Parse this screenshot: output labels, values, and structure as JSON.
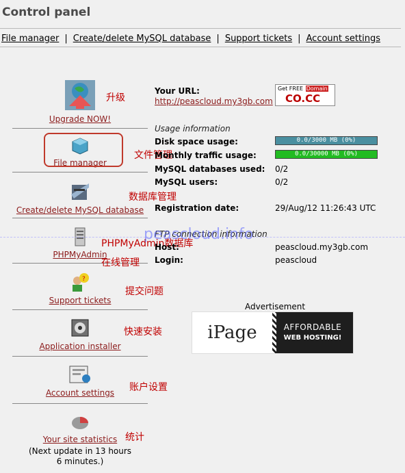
{
  "title": "Control panel",
  "topnav": [
    {
      "label": "File manager"
    },
    {
      "label": "Create/delete MySQL database"
    },
    {
      "label": "Support tickets"
    },
    {
      "label": "Account settings"
    }
  ],
  "sidebar": {
    "items": [
      {
        "label": "Upgrade NOW!",
        "icon": "upgrade-globe-icon",
        "cn": "升级"
      },
      {
        "label": "File manager",
        "icon": "file-manager-cube-icon",
        "cn": "文件管理"
      },
      {
        "label": "Create/delete MySQL database",
        "icon": "mysql-database-icon",
        "cn": "数据库管理"
      },
      {
        "label": "PHPMyAdmin",
        "icon": "phpmyadmin-server-icon",
        "cn": "PHPMyAdmin数据库"
      },
      {
        "label": "Support tickets",
        "icon": "support-people-icon",
        "cn": "提交问题"
      },
      {
        "label": "Application installer",
        "icon": "installer-icon",
        "cn": "快速安装"
      },
      {
        "label": "Account settings",
        "icon": "settings-icon",
        "cn": "账户设置"
      },
      {
        "label": "Your site statistics",
        "icon": "statistics-icon",
        "cn": "统计"
      }
    ],
    "online_cn": "在线管理",
    "stats_note": "(Next update in 13 hours 6 minutes.)"
  },
  "account": {
    "your_url_label": "Your URL:",
    "your_url": "http://peascloud.my3gb.com",
    "usage_heading": "Usage information",
    "disk_label": "Disk space usage:",
    "disk_bar": "0.0/3000 MB (0%)",
    "disk_fraction": 0.0,
    "traffic_label": "Monthly traffic usage:",
    "traffic_bar": "0.0/30000 MB (0%)",
    "traffic_fraction": 0.0,
    "mysql_db_label": "MySQL databases used:",
    "mysql_db_value": "0/2",
    "mysql_users_label": "MySQL users:",
    "mysql_users_value": "0/2",
    "reg_label": "Registration date:",
    "reg_value": "29/Aug/12 11:26:43 UTC",
    "ftp_heading": "FTP connection information",
    "host_label": "Host:",
    "host_value": "peascloud.my3gb.com",
    "login_label": "Login:",
    "login_value": "peascloud"
  },
  "promo": {
    "line1a": "Get FREE ",
    "line1b": "Domain",
    "line2": "CO.CC"
  },
  "watermark": "peascloud.info",
  "ad": {
    "label": "Advertisement",
    "brand": "iPage",
    "line1": "AFFORDABLE",
    "line2": "WEB HOSTING!"
  },
  "colors": {
    "disk_bar": "#4a8fa0",
    "traffic_bar": "#22bb22",
    "link": "#8b1a1a",
    "cn_text": "#c00000"
  }
}
